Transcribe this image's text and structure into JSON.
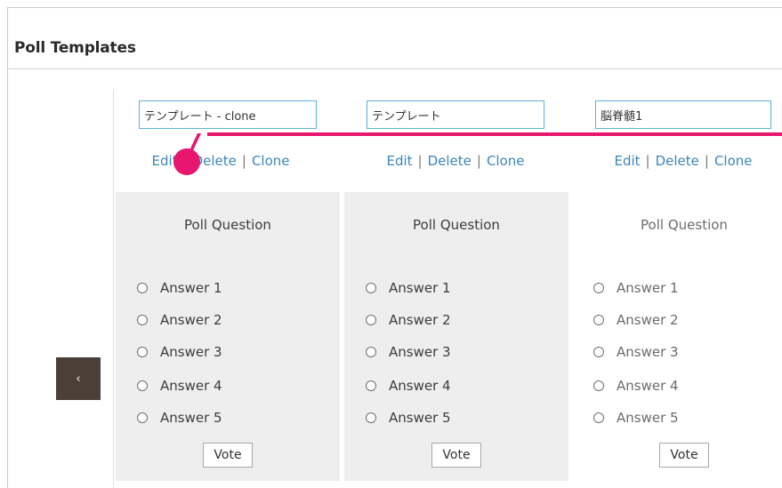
{
  "panel": {
    "title": "Poll Templates"
  },
  "carousel": {
    "prev_label": "‹"
  },
  "links": {
    "edit": "Edit",
    "delete": "Delete",
    "clone": "Clone",
    "separator": "|"
  },
  "templates": [
    {
      "name": "テンプレート - clone",
      "question": "Poll Question",
      "answers": [
        "Answer 1",
        "Answer 2",
        "Answer 3",
        "Answer 4",
        "Answer 5"
      ],
      "vote_label": "Vote",
      "background": "#eeeeee"
    },
    {
      "name": "テンプレート",
      "question": "Poll Question",
      "answers": [
        "Answer 1",
        "Answer 2",
        "Answer 3",
        "Answer 4",
        "Answer 5"
      ],
      "vote_label": "Vote",
      "background": "#eeeeee"
    },
    {
      "name": "脳脊髄1",
      "question": "Poll Question",
      "answers": [
        "Answer 1",
        "Answer 2",
        "Answer 3",
        "Answer 4",
        "Answer 5"
      ],
      "vote_label": "Vote",
      "background": "#ffffff"
    }
  ],
  "colors": {
    "accent_callout": "#e8166e",
    "link": "#3b86b8",
    "input_border": "#5ab3d6",
    "nav_button": "#4a4038"
  }
}
